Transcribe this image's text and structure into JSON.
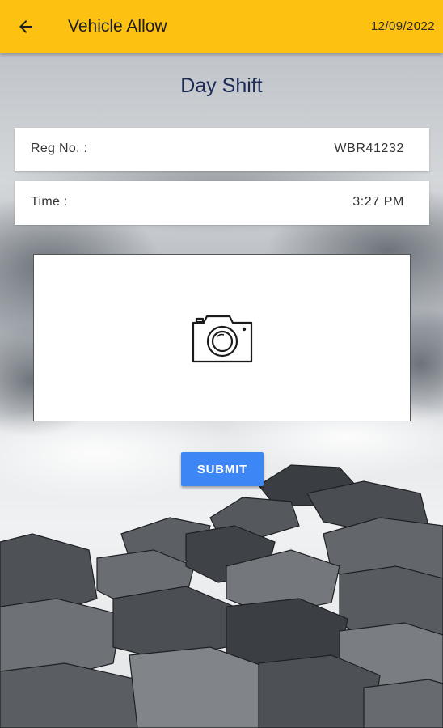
{
  "app_bar": {
    "title": "Vehicle Allow",
    "date": "12/09/2022",
    "back_icon": "arrow-left-icon",
    "background": "#fdc211"
  },
  "page": {
    "heading": "Day Shift"
  },
  "fields": [
    {
      "label": "Reg No. :",
      "value": "WBR41232"
    },
    {
      "label": "Time :",
      "value": "3:27 PM"
    }
  ],
  "photo": {
    "icon": "camera-icon"
  },
  "submit": {
    "label": "SUBMIT",
    "color": "#3c87f5"
  }
}
